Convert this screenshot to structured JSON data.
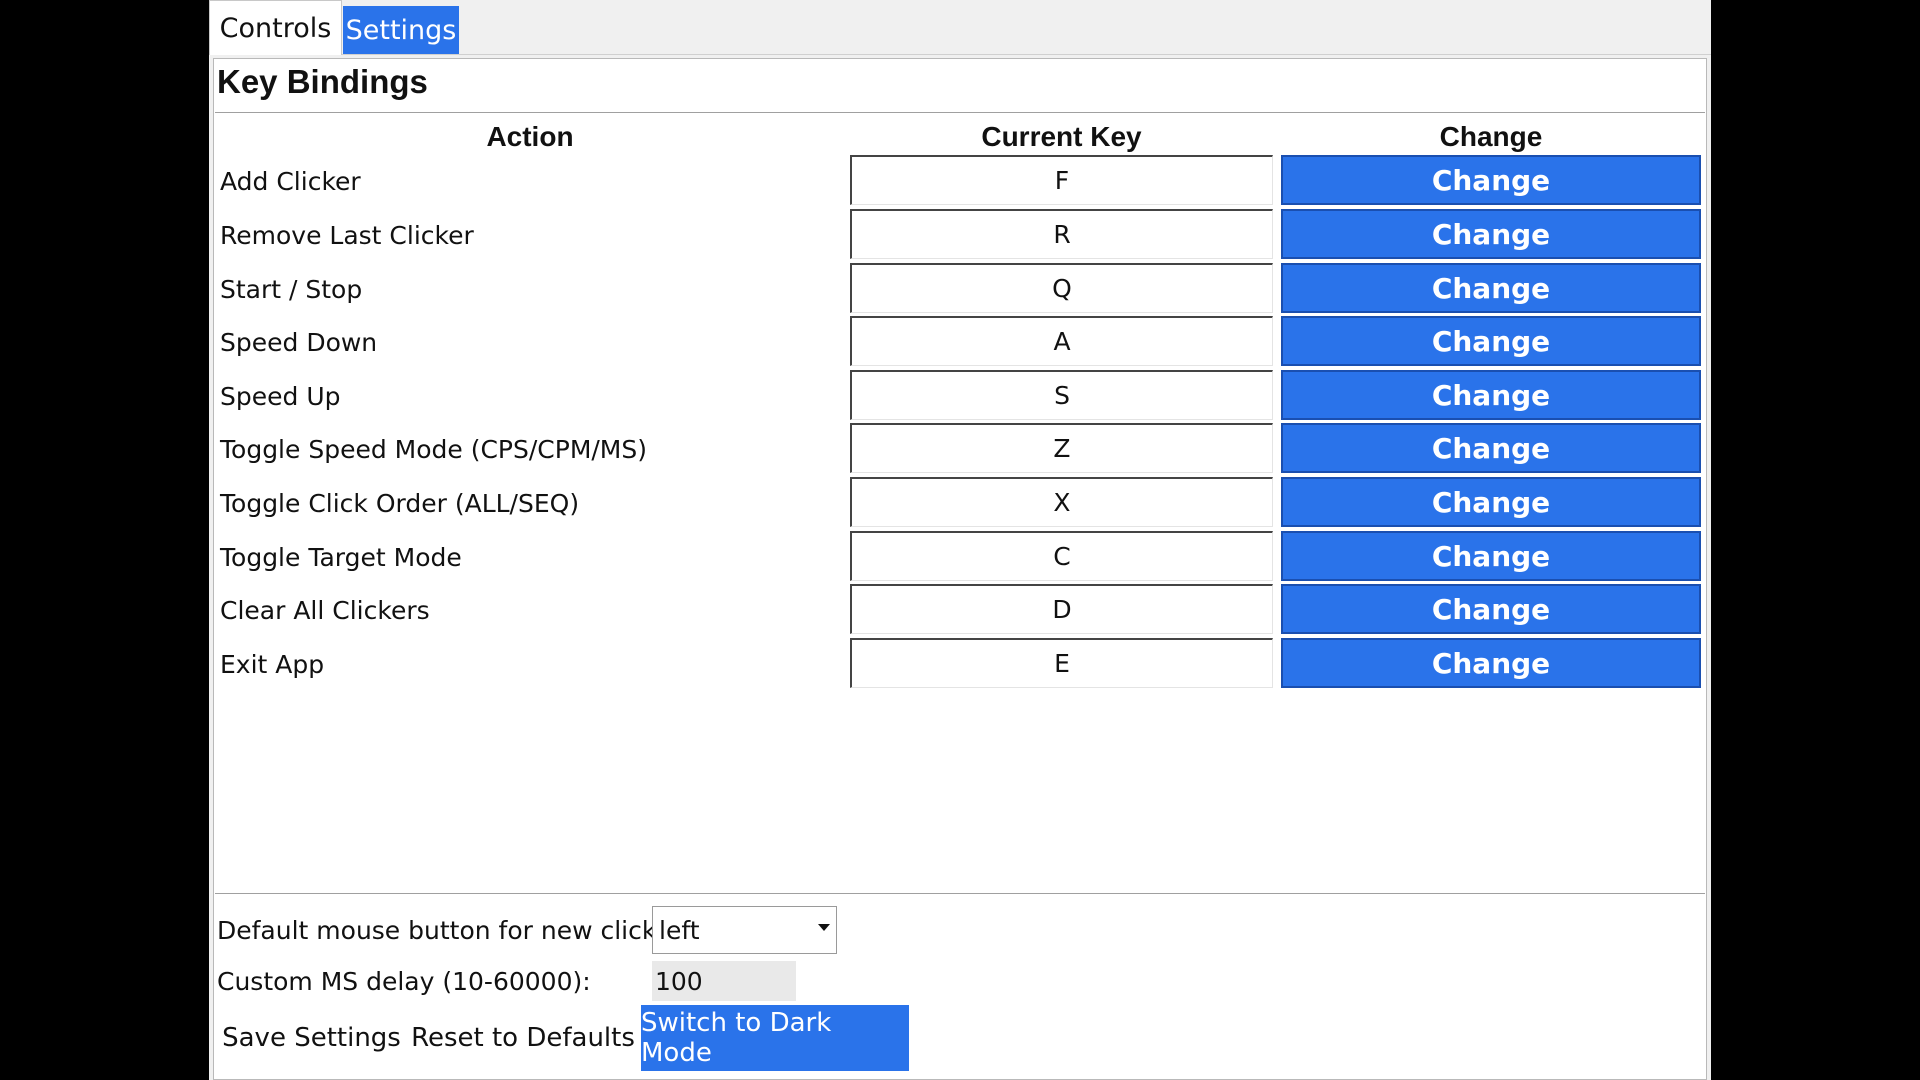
{
  "tabs": [
    {
      "label": "Controls",
      "active": false
    },
    {
      "label": "Settings",
      "active": true
    }
  ],
  "heading": "Key Bindings",
  "columns": {
    "action": "Action",
    "current_key": "Current Key",
    "change": "Change"
  },
  "bindings": [
    {
      "action": "Add Clicker",
      "key": "F",
      "button": "Change"
    },
    {
      "action": "Remove Last Clicker",
      "key": "R",
      "button": "Change"
    },
    {
      "action": "Start / Stop",
      "key": "Q",
      "button": "Change"
    },
    {
      "action": "Speed Down",
      "key": "A",
      "button": "Change"
    },
    {
      "action": "Speed Up",
      "key": "S",
      "button": "Change"
    },
    {
      "action": "Toggle Speed Mode (CPS/CPM/MS)",
      "key": "Z",
      "button": "Change"
    },
    {
      "action": "Toggle Click Order (ALL/SEQ)",
      "key": "X",
      "button": "Change"
    },
    {
      "action": "Toggle Target Mode",
      "key": "C",
      "button": "Change"
    },
    {
      "action": "Clear All Clickers",
      "key": "D",
      "button": "Change"
    },
    {
      "action": "Exit App",
      "key": "E",
      "button": "Change"
    }
  ],
  "settings": {
    "mouse_button_label": "Default mouse button for new clickers:",
    "mouse_button_value": "left",
    "delay_label": "Custom MS delay (10-60000):",
    "delay_value": "100"
  },
  "buttons": {
    "save": "Save Settings",
    "reset": "Reset to Defaults",
    "dark_mode": "Switch to Dark Mode"
  },
  "colors": {
    "accent": "#2a73ea",
    "background": "#000000",
    "panel": "#ffffff"
  }
}
